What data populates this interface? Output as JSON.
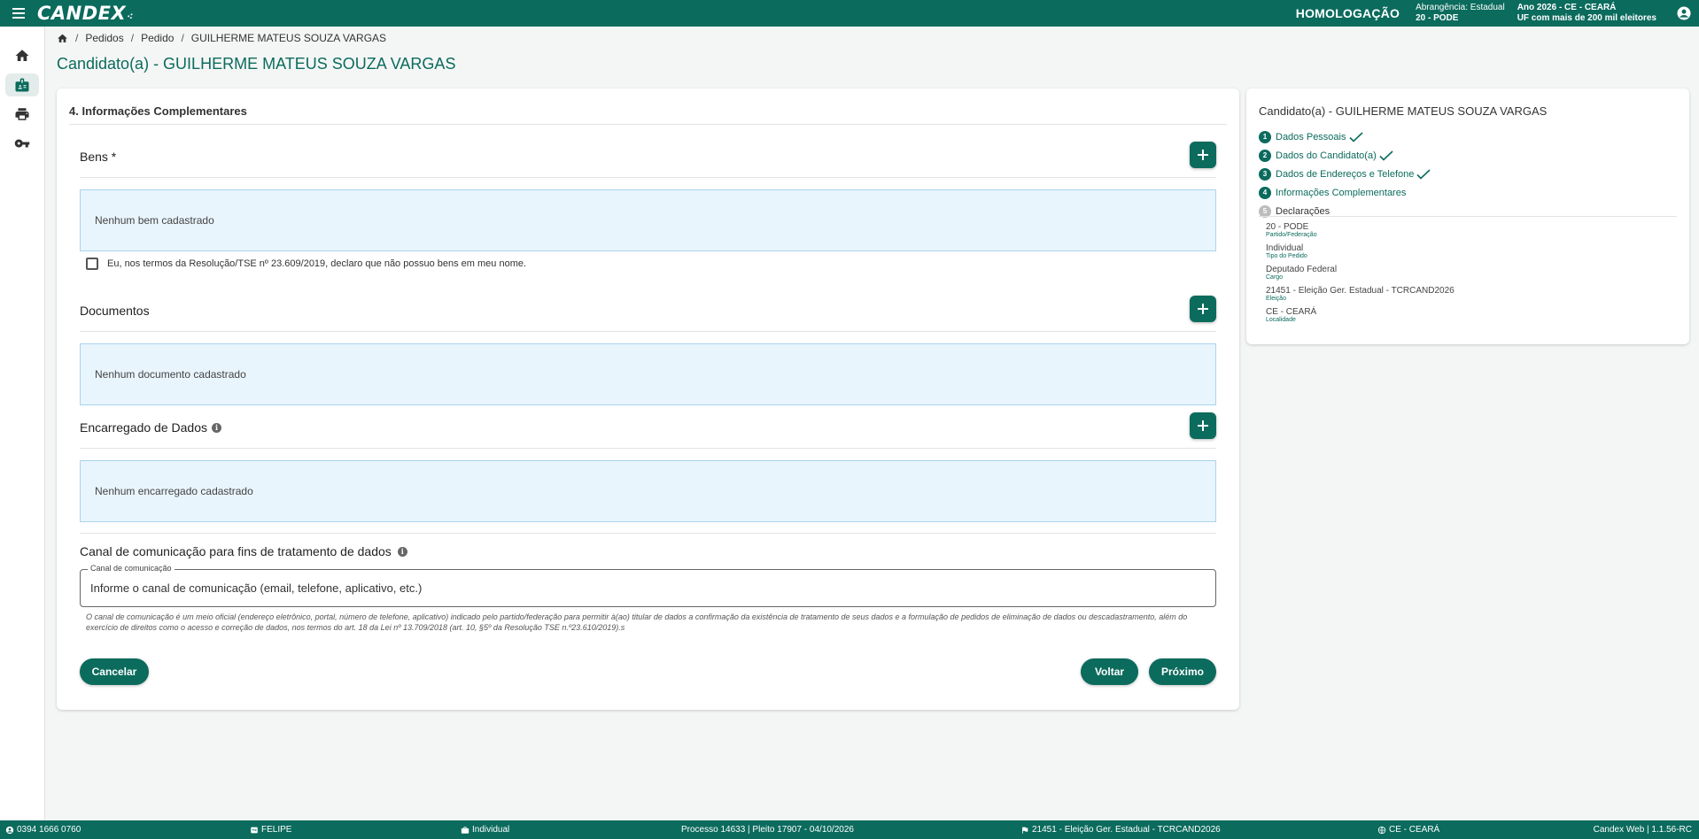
{
  "app": {
    "logo": "CANDEX",
    "env_label": "HOMOLOGAÇÃO",
    "scope_line1": "Abrangência: Estadual",
    "scope_line2": "20 - PODE",
    "year_line1": "Ano 2026 - CE - CEARÁ",
    "year_line2": "UF com mais de 200 mil eleitores"
  },
  "sidebar": {
    "items": [
      {
        "icon": "home-icon"
      },
      {
        "icon": "badge-icon"
      },
      {
        "icon": "print-icon"
      },
      {
        "icon": "key-icon"
      }
    ]
  },
  "breadcrumb": {
    "items": [
      "Pedidos",
      "Pedido",
      "GUILHERME MATEUS SOUZA VARGAS"
    ]
  },
  "page": {
    "title": "Candidato(a) - GUILHERME MATEUS SOUZA VARGAS"
  },
  "form": {
    "section_title": "4. Informações Complementares",
    "bens": {
      "title": "Bens *",
      "empty": "Nenhum bem cadastrado",
      "declaration": "Eu, nos termos da Resolução/TSE nº 23.609/2019, declaro que não possuo bens em meu nome."
    },
    "documentos": {
      "title": "Documentos",
      "empty": "Nenhum documento cadastrado"
    },
    "encarregado": {
      "title": "Encarregado de Dados",
      "empty": "Nenhum encarregado cadastrado"
    },
    "canal": {
      "title": "Canal de comunicação para fins de tratamento de dados",
      "field_label": "Canal de comunicação",
      "placeholder": "Informe o canal de comunicação (email, telefone, aplicativo, etc.)",
      "hint": "O canal de comunicação é um meio oficial (endereço eletrônico, portal, número de telefone, aplicativo) indicado pelo partido/federação para permitir à(ao) titular de dados a confirmação da existência de tratamento de seus dados e a formulação de pedidos de eliminação de dados ou descadastramento, além do exercício de direitos como o acesso e correção de dados, nos termos do art. 18 da Lei nº 13.709/2018 (art. 10, §5º da Resolução TSE n.º23.610/2019).s"
    },
    "buttons": {
      "cancel": "Cancelar",
      "back": "Voltar",
      "next": "Próximo"
    }
  },
  "summary": {
    "title": "Candidato(a) - GUILHERME MATEUS SOUZA VARGAS",
    "steps": [
      {
        "num": "1",
        "label": "Dados Pessoais",
        "done": true
      },
      {
        "num": "2",
        "label": "Dados do Candidato(a)",
        "done": true
      },
      {
        "num": "3",
        "label": "Dados de Endereços e Telefone",
        "done": true
      },
      {
        "num": "4",
        "label": "Informações Complementares",
        "done": false
      },
      {
        "num": "5",
        "label": "Declarações",
        "done": false
      }
    ],
    "meta": [
      {
        "value": "20 - PODE",
        "label": "Partido/Federação"
      },
      {
        "value": "Individual",
        "label": "Tipo do Pedido"
      },
      {
        "value": "Deputado Federal",
        "label": "Cargo"
      },
      {
        "value": "21451 - Eleição Ger. Estadual - TCRCAND2026",
        "label": "Eleição"
      },
      {
        "value": "CE - CEARÁ",
        "label": "Localidade"
      }
    ]
  },
  "footer": {
    "id": "0394 1666 0760",
    "user": "FELIPE",
    "type": "Individual",
    "process": "Processo 14633 | Pleito 17907 - 04/10/2026",
    "election": "21451 - Eleição Ger. Estadual - TCRCAND2026",
    "place": "CE - CEARÁ",
    "version": "Candex Web | 1.1.56-RC"
  },
  "colors": {
    "primary": "#0b6b5d",
    "info_bg": "#e9f5fd",
    "info_border": "#a9d3ee"
  }
}
